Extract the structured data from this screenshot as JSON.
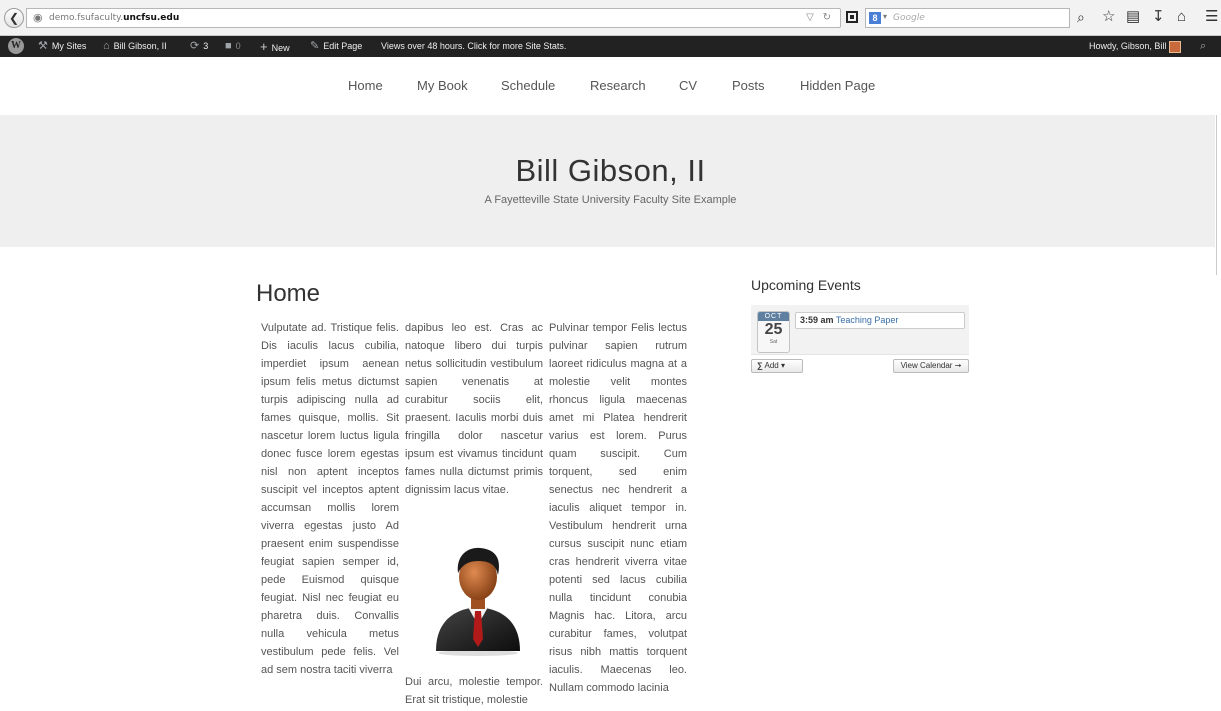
{
  "browser": {
    "url_prefix": "demo.fsufaculty.",
    "url_domain": "uncfsu.edu",
    "search_placeholder": "Google",
    "search_engine_letter": "8"
  },
  "adminbar": {
    "my_sites": "My Sites",
    "site_name": "Bill Gibson, II",
    "updates_count": "3",
    "comments_count": "0",
    "new_label": "New",
    "edit_page": "Edit Page",
    "stats_text": "Views over 48 hours. Click for more Site Stats.",
    "howdy": "Howdy, Gibson, Bill"
  },
  "nav": {
    "items": [
      "Home",
      "My Book",
      "Schedule",
      "Research",
      "CV",
      "Posts",
      "Hidden Page"
    ]
  },
  "header": {
    "title": "Bill Gibson, II",
    "description": "A Fayetteville State University Faculty Site Example"
  },
  "content": {
    "heading": "Home",
    "col1": "Vulputate ad. Tristique felis. Dis iaculis lacus cubilia, imperdiet ipsum aenean ipsum felis metus dictumst turpis adipiscing nulla ad fames quisque, mollis. Sit nascetur lorem luctus ligula donec fusce lorem egestas nisl non aptent inceptos suscipit vel inceptos aptent accumsan mollis lorem viverra egestas justo Ad praesent enim suspendisse feugiat sapien semper id, pede Euismod quisque feugiat. Nisl nec feugiat eu pharetra duis. Convallis nulla vehicula metus vestibulum pede felis. Vel ad sem nostra taciti viverra",
    "col2_top": "dapibus leo est. Cras ac natoque libero dui turpis netus sollicitudin vestibulum sapien venenatis at curabitur sociis elit, praesent. Iaculis morbi duis fringilla dolor nascetur ipsum est vivamus tincidunt fames nulla dictumst primis dignissim lacus vitae.",
    "col2_bottom": "Dui arcu, molestie tempor. Erat sit tristique, molestie",
    "col3": "Pulvinar tempor Felis lectus pulvinar sapien rutrum laoreet ridiculus magna at a molestie velit montes rhoncus ligula maecenas amet mi Platea hendrerit varius est lorem. Purus quam suscipit. Cum torquent, sed enim senectus nec hendrerit a iaculis aliquet tempor in. Vestibulum hendrerit urna cursus suscipit nunc etiam cras hendrerit viverra vitae potenti sed lacus cubilia nulla tincidunt conubia Magnis hac. Litora, arcu curabitur fames, volutpat risus nibh mattis torquent iaculis. Maecenas leo. Nullam commodo lacinia"
  },
  "sidebar": {
    "widget_title": "Upcoming Events",
    "event": {
      "month": "OCT",
      "day": "25",
      "weekday": "Sat",
      "time": "3:59 am",
      "title": "Teaching Paper"
    },
    "add_label": "Add",
    "view_calendar_label": "View Calendar"
  },
  "icons": {
    "back": "back-arrow-icon",
    "globe": "globe-icon",
    "star": "bookmark-star-icon",
    "download": "download-icon",
    "home": "home-icon",
    "menu": "menu-icon",
    "rss": "rss-icon"
  }
}
